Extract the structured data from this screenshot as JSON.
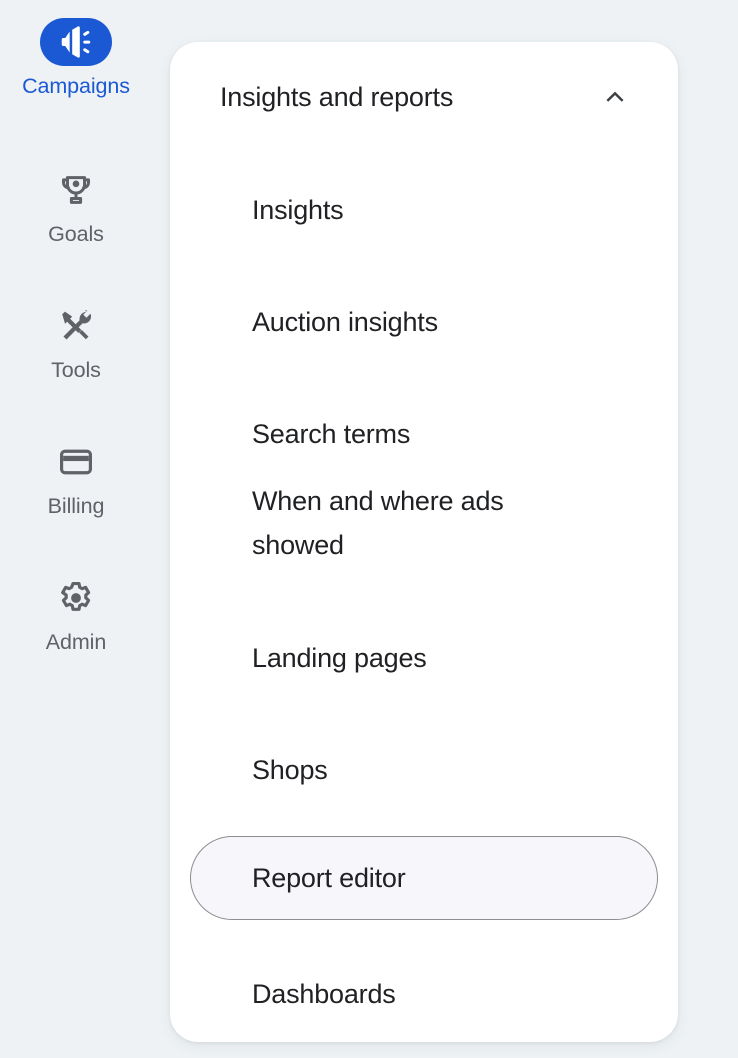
{
  "theme": {
    "page_background": "#eef2f5",
    "panel_background": "#ffffff",
    "accent_blue": "#1b59d4",
    "active_label_color": "#1b59d4",
    "inactive_label_color": "#5f6368",
    "menu_text_color": "#202124",
    "selected_item_fill": "#f7f7fb",
    "selected_item_border": "#8a8d91"
  },
  "nav_rail": {
    "items": [
      {
        "label": "Campaigns",
        "icon": "campaign-megaphone-icon",
        "active": true
      },
      {
        "label": "Goals",
        "icon": "trophy-icon",
        "active": false
      },
      {
        "label": "Tools",
        "icon": "hammer-wrench-icon",
        "active": false
      },
      {
        "label": "Billing",
        "icon": "credit-card-icon",
        "active": false
      },
      {
        "label": "Admin",
        "icon": "gear-icon",
        "active": false
      }
    ]
  },
  "panel": {
    "header": {
      "title": "Insights and reports",
      "collapse_icon": "chevron-up-icon"
    },
    "items": [
      {
        "label": "Insights",
        "selected": false
      },
      {
        "label": "Auction insights",
        "selected": false
      },
      {
        "label": "Search terms",
        "selected": false
      },
      {
        "label": "When and where ads showed",
        "selected": false
      },
      {
        "label": "Landing pages",
        "selected": false
      },
      {
        "label": "Shops",
        "selected": false
      },
      {
        "label": "Report editor",
        "selected": true
      },
      {
        "label": "Dashboards",
        "selected": false
      }
    ]
  }
}
